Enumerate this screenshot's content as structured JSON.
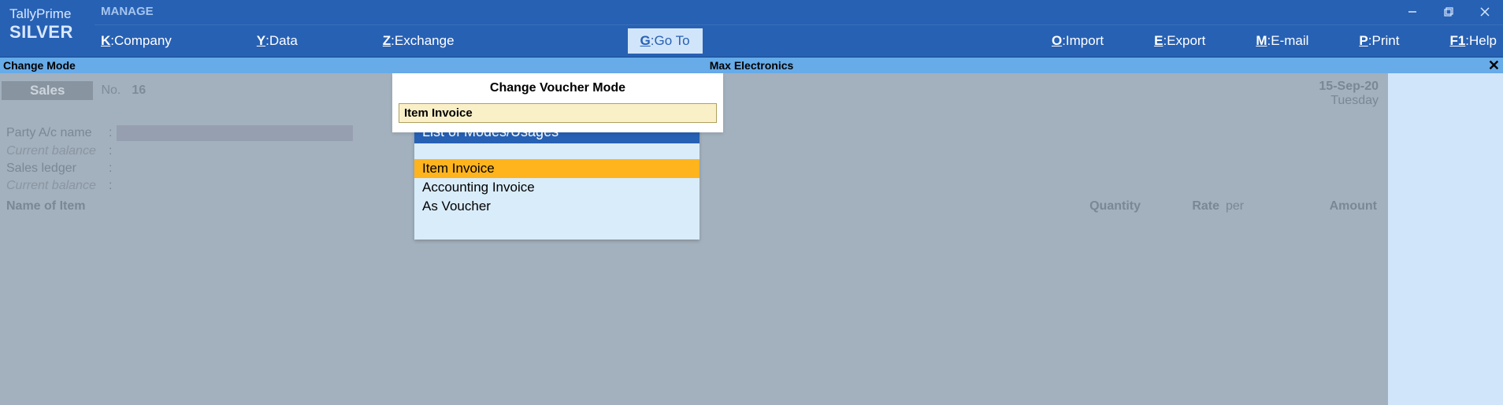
{
  "brand": {
    "name": "TallyPrime",
    "edition": "SILVER"
  },
  "manage": "MANAGE",
  "menu": {
    "company": {
      "key": "K",
      "label": "Company"
    },
    "data": {
      "key": "Y",
      "label": "Data"
    },
    "exchange": {
      "key": "Z",
      "label": "Exchange"
    },
    "goto": {
      "key": "G",
      "label": "Go To"
    },
    "import": {
      "key": "O",
      "label": "Import"
    },
    "export": {
      "key": "E",
      "label": "Export"
    },
    "email": {
      "key": "M",
      "label": "E-mail"
    },
    "print": {
      "key": "P",
      "label": "Print"
    },
    "help": {
      "key": "F1",
      "label": "Help"
    }
  },
  "subbar": {
    "mode": "Change Mode",
    "company": "Max Electronics"
  },
  "voucher": {
    "type": "Sales",
    "no_label": "No.",
    "no_value": "16",
    "date": "15-Sep-20",
    "day": "Tuesday",
    "party_label": "Party A/c name",
    "balance_label": "Current balance",
    "ledger_label": "Sales ledger",
    "columns": {
      "name": "Name of Item",
      "qty": "Quantity",
      "rate": "Rate",
      "per": "per",
      "amount": "Amount"
    }
  },
  "popup": {
    "title": "Change Voucher Mode",
    "input_value": "Item Invoice"
  },
  "dropdown": {
    "header": "List of Modes/Usages",
    "items": [
      "Item Invoice",
      "Accounting Invoice",
      "As Voucher"
    ],
    "selected_index": 0
  }
}
